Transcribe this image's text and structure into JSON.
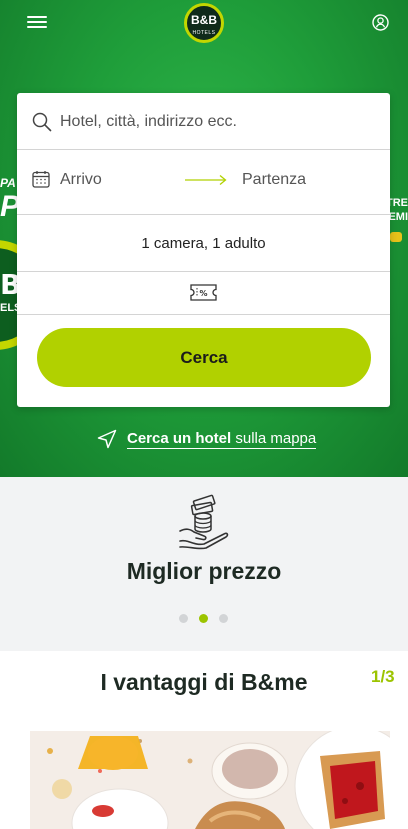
{
  "header": {
    "menu_icon": "hamburger-icon",
    "logo": {
      "main": "B&B",
      "sub": "HOTELS"
    },
    "account_icon": "user-account-icon"
  },
  "hero_decor": {
    "left_top": "PA",
    "left_big": "P",
    "left_badge": "B",
    "left_small": "ELS",
    "right": "TRE\nEMI"
  },
  "search": {
    "placeholder": "Hotel, città, indirizzo ecc.",
    "arrival": "Arrivo",
    "departure": "Partenza",
    "guests": "1 camera, 1 adulto",
    "promo_icon": "discount-ticket-icon",
    "submit": "Cerca"
  },
  "map_link": {
    "bold": "Cerca un hotel",
    "rest": " sulla mappa"
  },
  "carousel": {
    "title": "Miglior prezzo",
    "icon": "money-hand-icon",
    "slides": 3,
    "active_index": 1
  },
  "benefits": {
    "title": "I vantaggi di B&me",
    "page": "1/3"
  },
  "colors": {
    "accent": "#b1d100",
    "hero_green": "#1f9e3a",
    "dark_text": "#1e2a23",
    "page_indicator": "#9cc400"
  }
}
